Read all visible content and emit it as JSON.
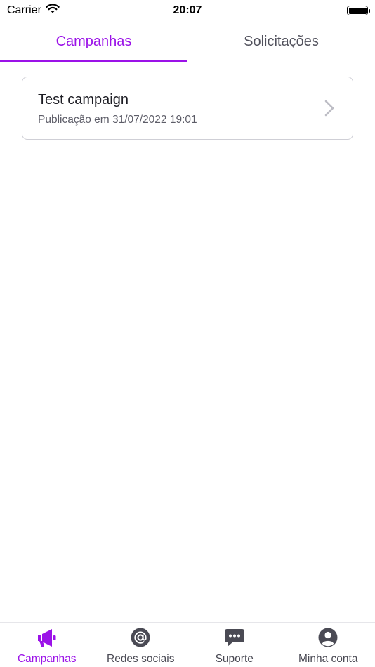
{
  "status_bar": {
    "carrier": "Carrier",
    "time": "20:07"
  },
  "top_tabs": [
    {
      "label": "Campanhas",
      "active": true
    },
    {
      "label": "Solicitações",
      "active": false
    }
  ],
  "campaigns": [
    {
      "title": "Test campaign",
      "subtitle": "Publicação em 31/07/2022 19:01"
    }
  ],
  "bottom_nav": [
    {
      "label": "Campanhas",
      "icon": "megaphone-icon",
      "active": true
    },
    {
      "label": "Redes sociais",
      "icon": "at-sign-icon",
      "active": false
    },
    {
      "label": "Suporte",
      "icon": "chat-bubble-icon",
      "active": false
    },
    {
      "label": "Minha conta",
      "icon": "user-circle-icon",
      "active": false
    }
  ],
  "colors": {
    "accent": "#9b12e8",
    "text": "#1f1f24",
    "muted": "#51515c"
  }
}
